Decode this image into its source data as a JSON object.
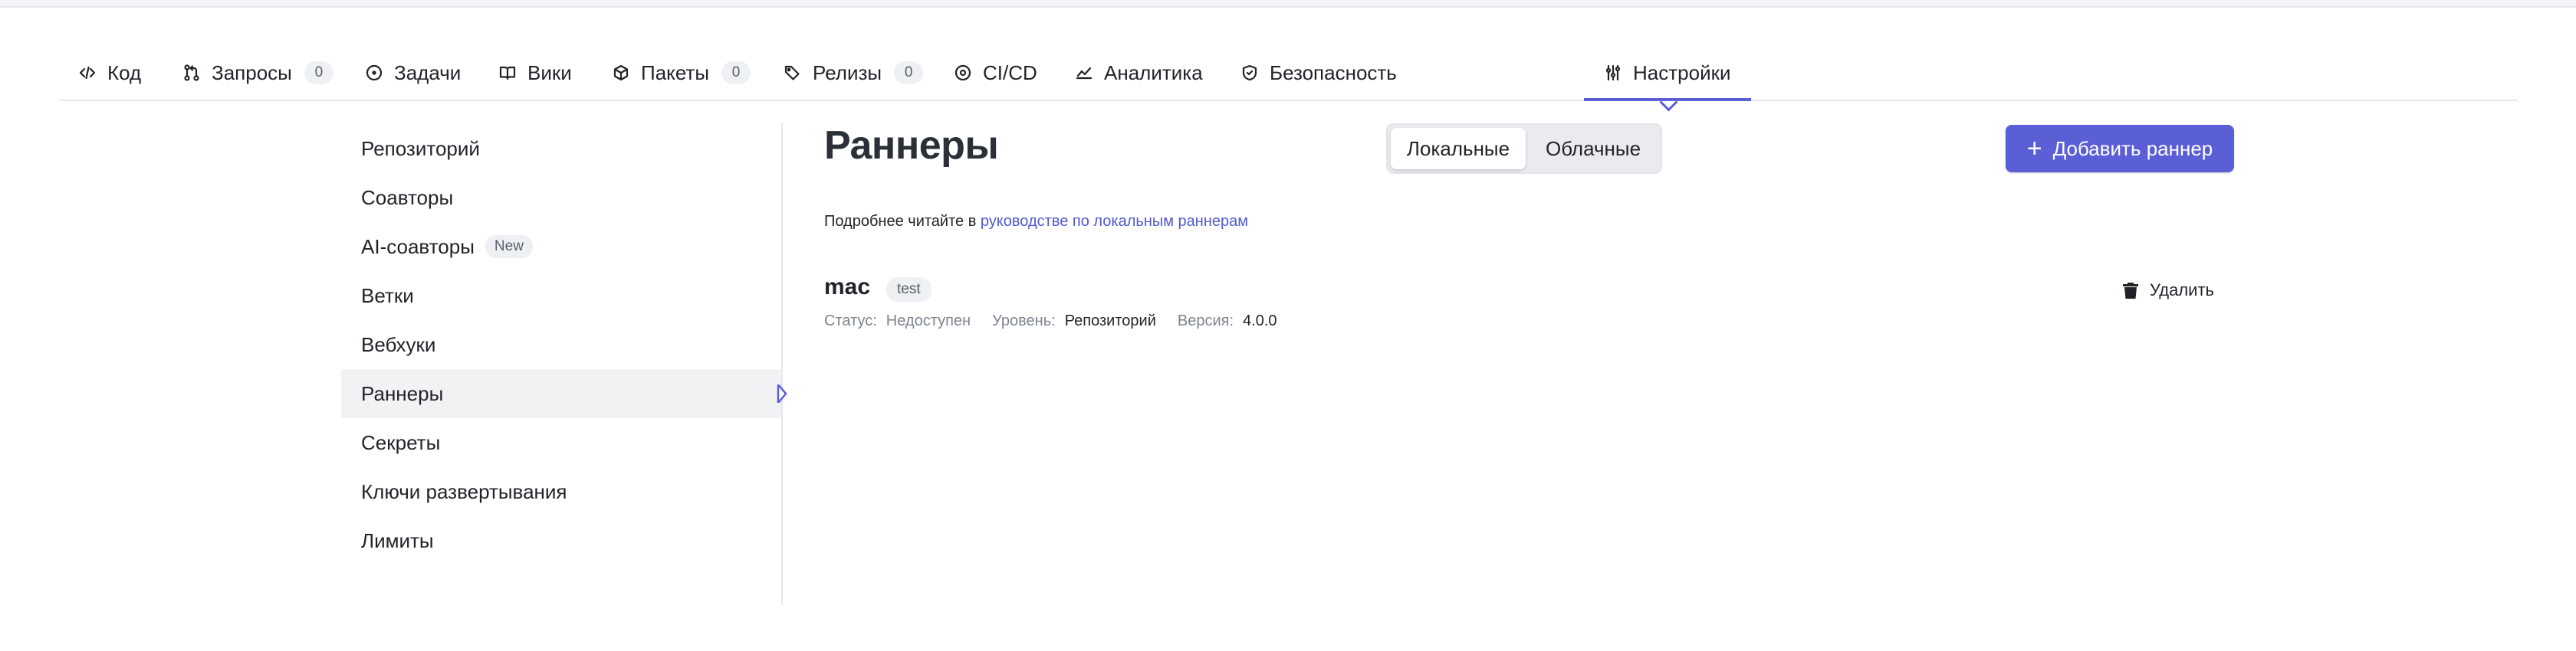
{
  "tabs": [
    {
      "label": "Код",
      "icon": "code-icon"
    },
    {
      "label": "Запросы",
      "icon": "pull-request-icon",
      "count": "0"
    },
    {
      "label": "Задачи",
      "icon": "issue-icon"
    },
    {
      "label": "Вики",
      "icon": "book-icon"
    },
    {
      "label": "Пакеты",
      "icon": "package-icon",
      "count": "0"
    },
    {
      "label": "Релизы",
      "icon": "tag-icon",
      "count": "0"
    },
    {
      "label": "CI/CD",
      "icon": "ci-icon"
    },
    {
      "label": "Аналитика",
      "icon": "chart-icon"
    },
    {
      "label": "Безопасность",
      "icon": "shield-icon"
    },
    {
      "label": "Настройки",
      "icon": "settings-sliders-icon",
      "active": true
    }
  ],
  "sidebar": {
    "items": [
      {
        "label": "Репозиторий"
      },
      {
        "label": "Соавторы"
      },
      {
        "label": "AI-соавторы",
        "badge": "New"
      },
      {
        "label": "Ветки"
      },
      {
        "label": "Вебхуки"
      },
      {
        "label": "Раннеры",
        "active": true
      },
      {
        "label": "Секреты"
      },
      {
        "label": "Ключи развертывания"
      },
      {
        "label": "Лимиты"
      }
    ]
  },
  "main": {
    "title": "Раннеры",
    "segment": {
      "local": "Локальные",
      "cloud": "Облачные",
      "selected": "Локальные"
    },
    "add_button": "Добавить раннер",
    "info_text": "Подробнее читайте в",
    "info_link": "руководстве по локальным раннерам",
    "runner": {
      "name": "mac",
      "tag": "test",
      "status_label": "Статус:",
      "status_value": "Недоступен",
      "level_label": "Уровень:",
      "level_value": "Репозиторий",
      "version_label": "Версия:",
      "version_value": "4.0.0",
      "delete_label": "Удалить"
    }
  },
  "colors": {
    "accent": "#5a5fd6",
    "link": "#5059cf",
    "muted": "#7d848e"
  }
}
